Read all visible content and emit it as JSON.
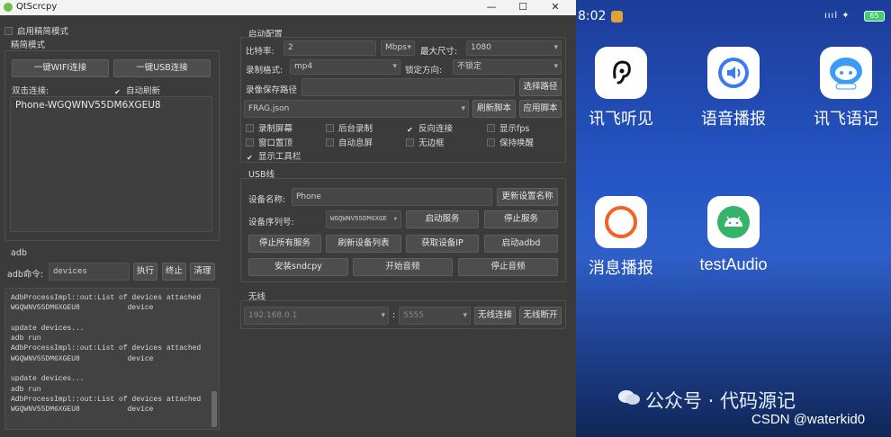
{
  "window": {
    "title": "QtScrcpy",
    "minimize": "—",
    "maximize": "☐",
    "close": "✕"
  },
  "left": {
    "enable_simple_mode": "启用精简模式",
    "simple_group_title": "精简模式",
    "wifi_connect": "一键WIFI连接",
    "usb_connect": "一键USB连接",
    "double_click_connect": "双击连接:",
    "auto_refresh": "自动刷新",
    "devices": [
      "Phone-WGQWNV55DM6XGEU8"
    ],
    "adb_group_title": "adb",
    "adb_cmd_label": "adb命令:",
    "adb_cmd_value": "devices",
    "execute": "执行",
    "terminate": "终止",
    "clear": "清理",
    "log": "AdbProcessImpl::out:List of devices attached\nWGQWNV55DM6XGEU8           device\n\nupdate devices...\nadb run\nAdbProcessImpl::out:List of devices attached\nWGQWNV55DM6XGEU8           device\n\nupdate devices...\nadb run\nAdbProcessImpl::out:List of devices attached\nWGQWNV55DM6XGEU8           device"
  },
  "start_config": {
    "title": "启动配置",
    "bitrate_label": "比特率:",
    "bitrate_value": "2",
    "bitrate_unit": "Mbps",
    "max_size_label": "最大尺寸:",
    "max_size_value": "1080",
    "record_format_label": "录制格式:",
    "record_format_value": "mp4",
    "lock_orientation_label": "锁定方向:",
    "lock_orientation_value": "不锁定",
    "record_path_label": "录像保存路径",
    "record_path_value": "",
    "choose_path": "选择路径",
    "script_value": "FRAG.json",
    "refresh_script": "刷新脚本",
    "apply_script": "应用脚本",
    "checkboxes": [
      {
        "label": "录制屏幕",
        "checked": false
      },
      {
        "label": "后台录制",
        "checked": false
      },
      {
        "label": "反向连接",
        "checked": true
      },
      {
        "label": "显示fps",
        "checked": false
      },
      {
        "label": "窗口置顶",
        "checked": false
      },
      {
        "label": "自动息屏",
        "checked": false
      },
      {
        "label": "无边框",
        "checked": false
      },
      {
        "label": "保持唤醒",
        "checked": false
      },
      {
        "label": "显示工具栏",
        "checked": true
      }
    ]
  },
  "usb": {
    "title": "USB线",
    "device_name_label": "设备名称:",
    "device_name_value": "Phone",
    "update_name": "更新设置名称",
    "serial_label": "设备序列号:",
    "serial_value": "WGQWNV55DM6XGE",
    "start_service": "启动服务",
    "stop_service": "停止服务",
    "stop_all": "停止所有服务",
    "refresh_devices": "刷新设备列表",
    "get_ip": "获取设备IP",
    "start_adbd": "启动adbd",
    "install_sndcpy": "安装sndcpy",
    "start_audio": "开始音频",
    "stop_audio": "停止音频"
  },
  "wireless": {
    "title": "无线",
    "ip_value": "192.168.0.1",
    "colon": ":",
    "port_value": "5555",
    "connect": "无线连接",
    "disconnect": "无线断开"
  },
  "phone": {
    "time": "8:02",
    "status_icons": "ıııl ✦",
    "battery": "65",
    "apps": [
      {
        "name": "讯飞听见",
        "icon": "ear-icon",
        "color": "#111111"
      },
      {
        "name": "语音播报",
        "icon": "speaker-icon",
        "color": "#3a7bf2"
      },
      {
        "name": "讯飞语记",
        "icon": "robot-icon",
        "color": "#3a9cf6"
      },
      {
        "name": "消息播报",
        "icon": "ring-icon",
        "color": "#f2622a"
      },
      {
        "name": "testAudio",
        "icon": "android-icon",
        "color": "#35b36b"
      }
    ],
    "watermark": "公众号 · 代码源记",
    "credit": "CSDN @waterkid0"
  }
}
